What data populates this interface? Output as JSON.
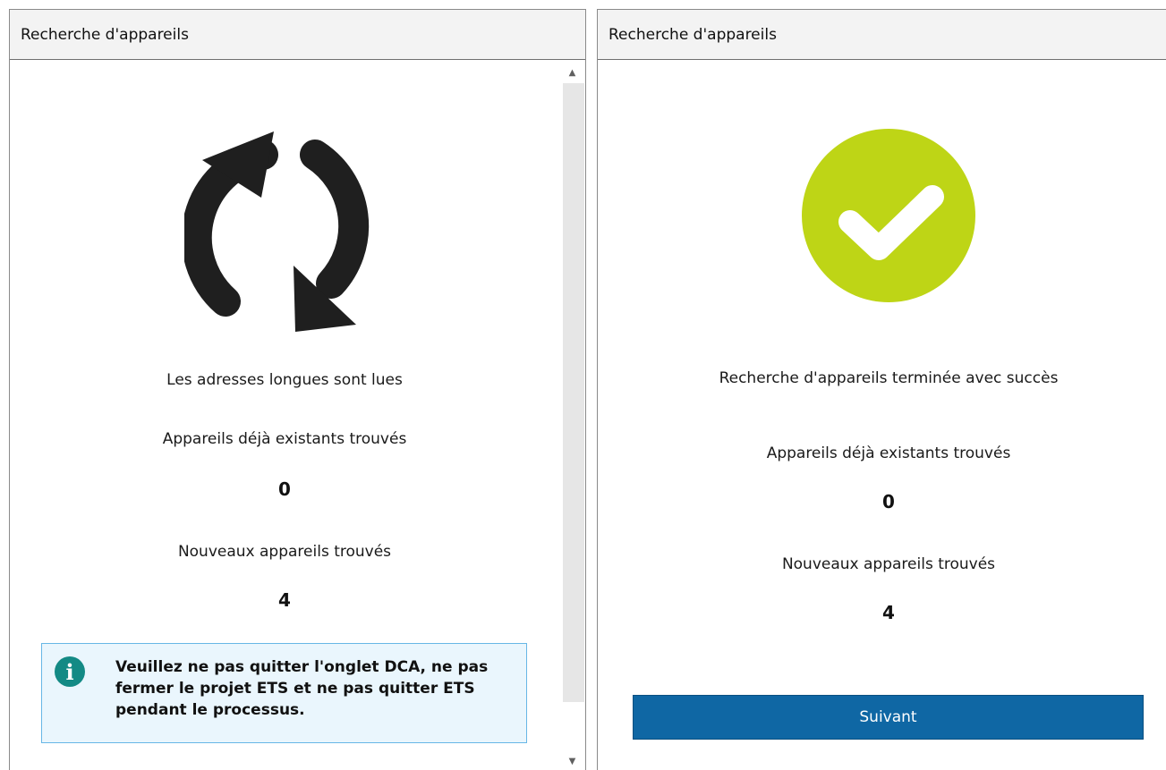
{
  "left_panel": {
    "title": "Recherche d'appareils",
    "status": "Les adresses longues sont lues",
    "existing_label": "Appareils déjà existants trouvés",
    "existing_count": "0",
    "new_label": "Nouveaux appareils trouvés",
    "new_count": "4",
    "info_message": "Veuillez ne pas quitter l'onglet DCA, ne pas fermer le projet ETS et ne pas quitter ETS pendant le processus.",
    "icon": "refresh-icon",
    "info_icon": "info-icon",
    "scroll_up_glyph": "▲",
    "scroll_down_glyph": "▼"
  },
  "right_panel": {
    "title": "Recherche d'appareils",
    "status": "Recherche d'appareils terminée avec succès",
    "existing_label": "Appareils déjà existants trouvés",
    "existing_count": "0",
    "new_label": "Nouveaux appareils trouvés",
    "new_count": "4",
    "next_button": "Suivant",
    "icon": "success-check-icon"
  },
  "colors": {
    "success": "#bed516",
    "info_icon": "#138a85",
    "info_background": "#eaf6fd",
    "info_border": "#67b7e6",
    "button": "#0f67a4",
    "refresh_icon": "#1f1f1f"
  }
}
